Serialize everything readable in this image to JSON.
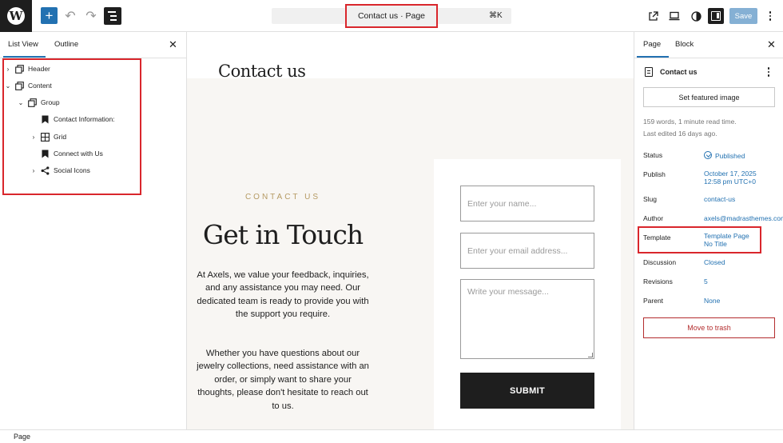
{
  "topbar": {
    "logo_letter": "W",
    "add_icon": "plus-icon",
    "undo_icon": "undo-icon",
    "redo_icon": "redo-icon",
    "document_title": "Contact us · Page",
    "shortcut": "⌘K",
    "save_label": "Save",
    "accent_color": "#2271b1"
  },
  "left_panel": {
    "tabs": [
      "List View",
      "Outline"
    ],
    "active_tab": "List View",
    "tree": [
      {
        "label": "Header",
        "level": 0,
        "expandable": true,
        "icon": "template-part-icon"
      },
      {
        "label": "Content",
        "level": 0,
        "expandable": true,
        "expanded": true,
        "icon": "template-part-icon"
      },
      {
        "label": "Group",
        "level": 1,
        "expandable": true,
        "expanded": true,
        "icon": "group-icon"
      },
      {
        "label": "Contact Information:",
        "level": 2,
        "expandable": false,
        "icon": "bookmark-icon"
      },
      {
        "label": "Grid",
        "level": 2,
        "expandable": true,
        "icon": "grid-icon"
      },
      {
        "label": "Connect with Us",
        "level": 2,
        "expandable": false,
        "icon": "bookmark-icon"
      },
      {
        "label": "Social Icons",
        "level": 2,
        "expandable": true,
        "icon": "share-icon"
      }
    ]
  },
  "canvas": {
    "page_heading": "Contact us",
    "eyebrow": "CONTACT US",
    "title": "Get in Touch",
    "paragraph1": "At Axels, we value your feedback, inquiries, and any assistance you may need. Our dedicated team is ready to provide you with the support you require.",
    "paragraph2": "Whether you have questions about our jewelry collections, need assistance with an order, or simply want to share your thoughts, please don't hesitate to reach out to us.",
    "form": {
      "name_placeholder": "Enter your name...",
      "email_placeholder": "Enter your email address...",
      "message_placeholder": "Write your message...",
      "submit_label": "SUBMIT"
    }
  },
  "right_panel": {
    "tabs": [
      "Page",
      "Block"
    ],
    "active_tab": "Page",
    "title": "Contact us",
    "featured_image_label": "Set featured image",
    "meta_words": "159 words, 1 minute read time.",
    "meta_edited": "Last edited 16 days ago.",
    "rows": {
      "status": {
        "label": "Status",
        "value": "Published"
      },
      "publish": {
        "label": "Publish",
        "value_line1": "October 17, 2025",
        "value_line2": "12:58 pm UTC+0"
      },
      "slug": {
        "label": "Slug",
        "value": "contact-us"
      },
      "author": {
        "label": "Author",
        "value": "axels@madrasthemes.com"
      },
      "template": {
        "label": "Template",
        "value_line1": "Template Page",
        "value_line2": "No Title"
      },
      "discussion": {
        "label": "Discussion",
        "value": "Closed"
      },
      "revisions": {
        "label": "Revisions",
        "value": "5"
      },
      "parent": {
        "label": "Parent",
        "value": "None"
      }
    },
    "trash_label": "Move to trash"
  },
  "footer": {
    "breadcrumb": "Page"
  }
}
